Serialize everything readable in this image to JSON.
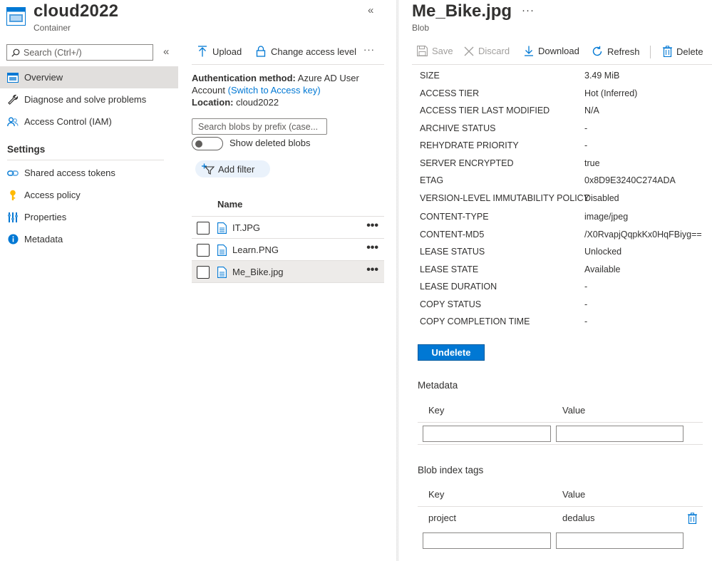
{
  "container": {
    "title": "cloud2022",
    "subtitle": "Container"
  },
  "menu": {
    "search_placeholder": "Search (Ctrl+/)",
    "items": [
      {
        "label": "Overview",
        "icon": "overview-icon",
        "active": true
      },
      {
        "label": "Diagnose and solve problems",
        "icon": "wrench-icon"
      },
      {
        "label": "Access Control (IAM)",
        "icon": "people-icon"
      }
    ],
    "settings_title": "Settings",
    "settings_items": [
      {
        "label": "Shared access tokens",
        "icon": "link-chain-icon"
      },
      {
        "label": "Access policy",
        "icon": "key-icon"
      },
      {
        "label": "Properties",
        "icon": "properties-bars-icon"
      },
      {
        "label": "Metadata",
        "icon": "info-icon"
      }
    ]
  },
  "content": {
    "toolbar": {
      "upload": "Upload",
      "change_access": "Change access level",
      "more": "···"
    },
    "auth_label": "Authentication method:",
    "auth_value": "Azure AD User Account",
    "auth_value_1": "Azure AD User",
    "auth_value_2": "Account",
    "auth_link": "(Switch to Access key)",
    "location_label": "Location:",
    "location_value": "cloud2022",
    "blob_search_placeholder": "Search blobs by prefix (case...",
    "show_deleted": "Show deleted blobs",
    "add_filter": "Add filter",
    "column_name": "Name",
    "blobs": [
      {
        "name": "IT.JPG",
        "selected": false
      },
      {
        "name": "Learn.PNG",
        "selected": false
      },
      {
        "name": "Me_Bike.jpg",
        "selected": true
      }
    ],
    "row_more": "•••"
  },
  "blob": {
    "title": "Me_Bike.jpg",
    "subtitle": "Blob",
    "more": "···",
    "toolbar": {
      "save": "Save",
      "discard": "Discard",
      "download": "Download",
      "refresh": "Refresh",
      "delete": "Delete"
    },
    "properties": [
      {
        "key": "SIZE",
        "value": "3.49 MiB"
      },
      {
        "key": "ACCESS TIER",
        "value": "Hot (Inferred)"
      },
      {
        "key": "ACCESS TIER LAST MODIFIED",
        "value": "N/A"
      },
      {
        "key": "ARCHIVE STATUS",
        "value": "-"
      },
      {
        "key": "REHYDRATE PRIORITY",
        "value": "-"
      },
      {
        "key": "SERVER ENCRYPTED",
        "value": "true"
      },
      {
        "key": "ETAG",
        "value": "0x8D9E3240C274ADA"
      },
      {
        "key": "VERSION-LEVEL IMMUTABILITY POLICY",
        "value": "Disabled"
      },
      {
        "key": "CONTENT-TYPE",
        "value": "image/jpeg"
      },
      {
        "key": "CONTENT-MD5",
        "value": "/X0RvapjQqpkKx0HqFBiyg=="
      },
      {
        "key": "LEASE STATUS",
        "value": "Unlocked"
      },
      {
        "key": "LEASE STATE",
        "value": "Available"
      },
      {
        "key": "LEASE DURATION",
        "value": "-"
      },
      {
        "key": "COPY STATUS",
        "value": "-"
      },
      {
        "key": "COPY COMPLETION TIME",
        "value": "-"
      }
    ],
    "undelete": "Undelete",
    "metadata": {
      "title": "Metadata",
      "key_header": "Key",
      "value_header": "Value"
    },
    "tags": {
      "title": "Blob index tags",
      "key_header": "Key",
      "value_header": "Value",
      "rows": [
        {
          "key": "project",
          "value": "dedalus"
        }
      ]
    }
  },
  "colors": {
    "accent": "#0078d4",
    "active_menu_bg": "#e1dfdd",
    "selected_row_bg": "#edebe9",
    "filter_pill_bg": "#eaf2fb"
  }
}
